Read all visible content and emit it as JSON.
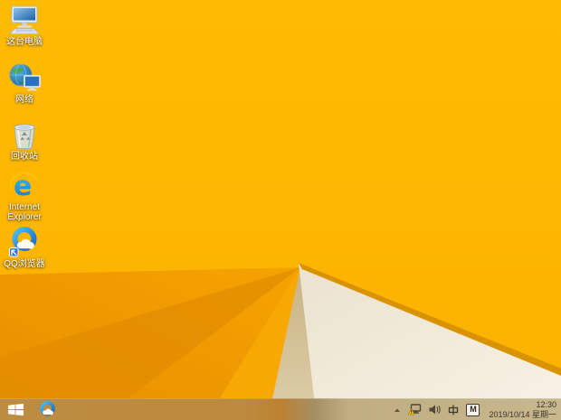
{
  "os": "Windows 8.1 desktop",
  "desktop": {
    "icons": [
      {
        "icon": "this-pc-icon",
        "label": "这台电脑"
      },
      {
        "icon": "network-icon",
        "label": "网络"
      },
      {
        "icon": "recycle-bin-icon",
        "label": "回收站"
      },
      {
        "icon": "internet-explorer-icon",
        "label": "Internet Explorer"
      },
      {
        "icon": "qq-browser-icon",
        "label": "QQ浏览器"
      }
    ]
  },
  "taskbar": {
    "start_icon": "windows-logo",
    "pinned": [
      {
        "icon": "qq-browser-icon"
      }
    ]
  },
  "tray": {
    "hidden_icons_icon": "chevron-up",
    "network_icon": "network-warning",
    "volume_icon": "speaker",
    "ime_lang": "中",
    "ime_mode": "M"
  },
  "clock": {
    "time": "12:30",
    "date": "2019/10/14 星期一"
  },
  "colors": {
    "wallpaper_gold": "#ffb900",
    "wallpaper_shadow_orange": "#e08a00",
    "wallpaper_cream": "#f2ecdd",
    "wallpaper_fold_edge": "#d99300",
    "taskbar_left": "#bc8c41",
    "taskbar_right": "#c8b78d",
    "qq_blue": "#1e7fd0",
    "ie_blue": "#28a8e0",
    "warning_yellow": "#f7c600"
  }
}
